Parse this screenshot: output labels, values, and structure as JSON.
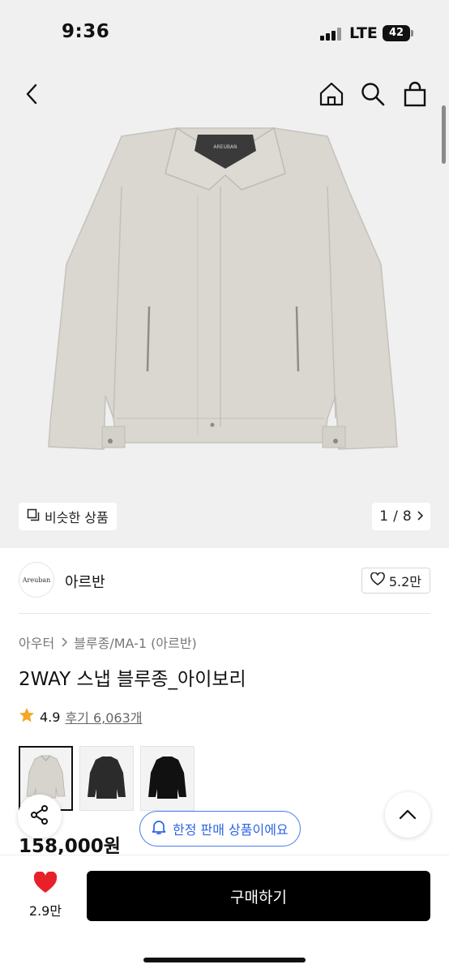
{
  "status_bar": {
    "time": "9:36",
    "network": "LTE",
    "battery": "42"
  },
  "nav": {
    "back_icon": "chevron-left-icon",
    "home_icon": "home-icon",
    "search_icon": "search-icon",
    "cart_icon": "shopping-bag-icon"
  },
  "hero": {
    "similar_label": "비슷한 상품",
    "page_current": "1",
    "page_total": "8",
    "page_separator": "/",
    "brand_tag": "AREUBAN"
  },
  "brand": {
    "logo_text": "Areuban",
    "name": "아르반",
    "likes": "5.2만"
  },
  "breadcrumb": {
    "level1": "아우터",
    "level2": "블루종/MA-1 (아르반)"
  },
  "product": {
    "title": "2WAY 스냅 블루종_아이보리",
    "rating": "4.9",
    "reviews": "후기 6,063개",
    "price": "158,000원",
    "limited_label": "한정 판매 상품이에요"
  },
  "swatches": [
    {
      "color_name": "ivory",
      "color": "#d6d4cd"
    },
    {
      "color_name": "charcoal",
      "color": "#2b2b2b"
    },
    {
      "color_name": "black",
      "color": "#111111"
    }
  ],
  "bottom_bar": {
    "wish_count": "2.9만",
    "buy_label": "구매하기"
  },
  "colors": {
    "accent_blue": "#2f64e6",
    "heart_red": "#e8202a",
    "star_orange": "#f5a623",
    "jacket": "#d9d7d0"
  }
}
